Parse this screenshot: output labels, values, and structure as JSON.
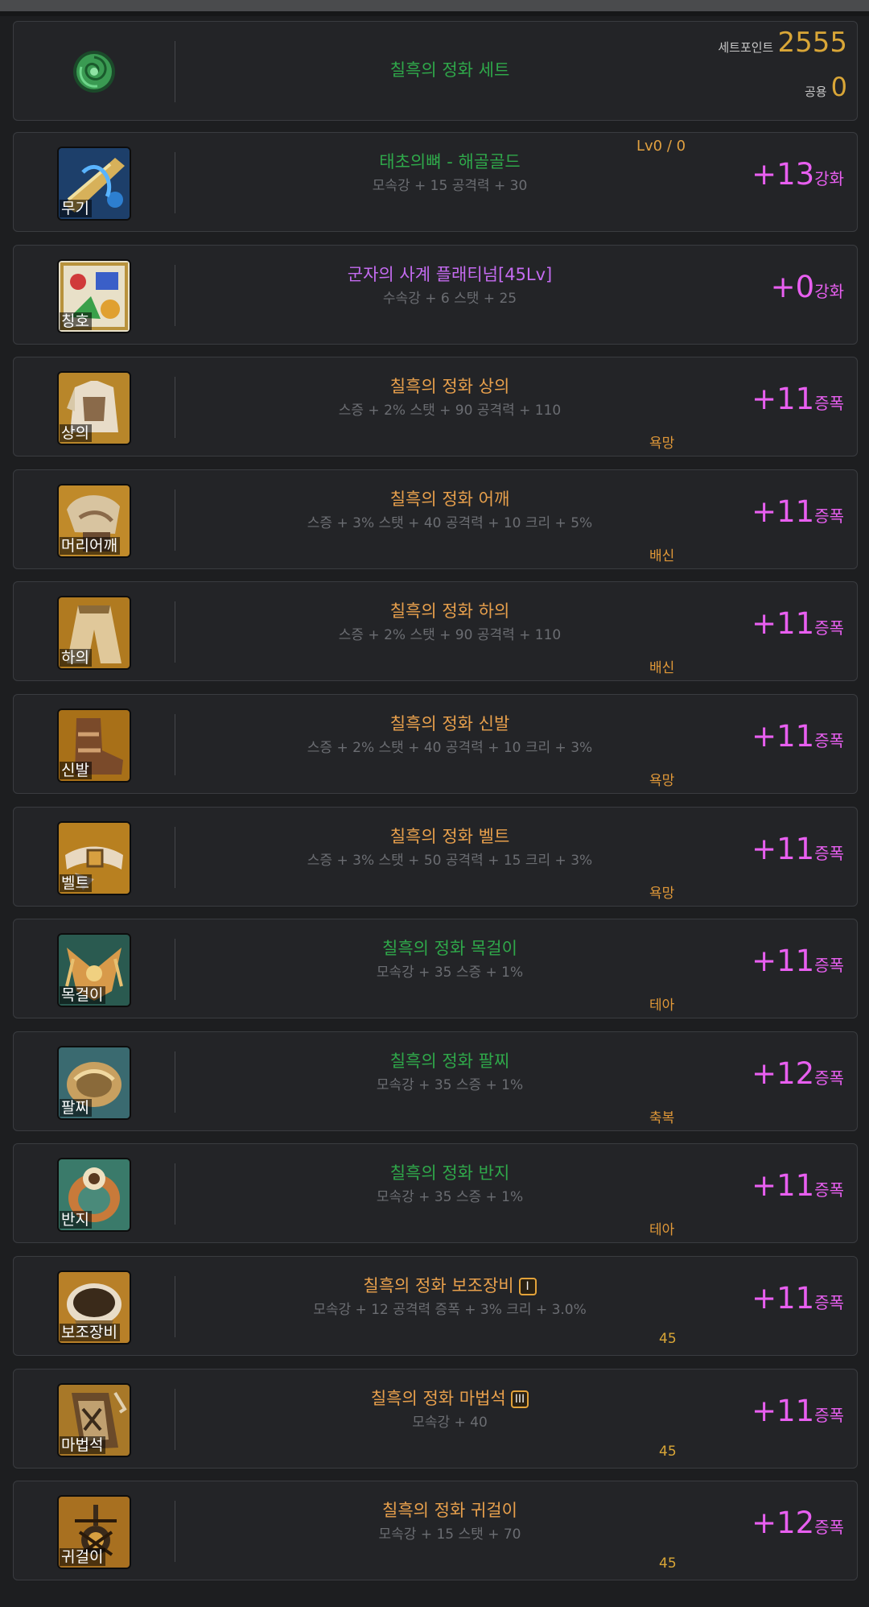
{
  "set": {
    "name": "칠흑의 정화 세트",
    "point_label": "세트포인트",
    "point_value": "2555",
    "common_label": "공용",
    "common_value": "0",
    "icon": "green-rose-icon"
  },
  "colors": {
    "purple": "#e85ff0",
    "orange": "#e8a04c",
    "gold": "#d9a637",
    "green": "#2fa84a",
    "violet": "#c46bf0",
    "gray": "#6b6d72"
  },
  "items": [
    {
      "slot": "무기",
      "name": "태초의뼈 - 해골골드",
      "name_color": "green",
      "stats": "모속강 + 15 공격력 + 30",
      "level": "Lv0 / 0",
      "enh_value": "+13",
      "enh_unit": "강화",
      "icon": "weapon-icon"
    },
    {
      "slot": "칭호",
      "name": "군자의 사계 플래티넘[45Lv]",
      "name_color": "violet",
      "stats": "수속강 + 6 스탯 + 25",
      "enh_value": "+0",
      "enh_unit": "강화",
      "icon": "title-icon"
    },
    {
      "slot": "상의",
      "name": "칠흑의 정화 상의",
      "name_color": "orange",
      "stats": "스증 + 2% 스탯 + 90 공격력 + 110",
      "tag": "욕망",
      "enh_value": "+11",
      "enh_unit": "증폭",
      "icon": "top-armor-icon"
    },
    {
      "slot": "머리어깨",
      "name": "칠흑의 정화 어깨",
      "name_color": "orange",
      "stats": "스증 + 3% 스탯 + 40 공격력 + 10 크리 + 5%",
      "tag": "배신",
      "enh_value": "+11",
      "enh_unit": "증폭",
      "icon": "shoulder-armor-icon"
    },
    {
      "slot": "하의",
      "name": "칠흑의 정화 하의",
      "name_color": "orange",
      "stats": "스증 + 2% 스탯 + 90 공격력 + 110",
      "tag": "배신",
      "enh_value": "+11",
      "enh_unit": "증폭",
      "icon": "bottom-armor-icon"
    },
    {
      "slot": "신발",
      "name": "칠흑의 정화 신발",
      "name_color": "orange",
      "stats": "스증 + 2% 스탯 + 40 공격력 + 10 크리 + 3%",
      "tag": "욕망",
      "enh_value": "+11",
      "enh_unit": "증폭",
      "icon": "shoes-icon"
    },
    {
      "slot": "벨트",
      "name": "칠흑의 정화 벨트",
      "name_color": "orange",
      "stats": "스증 + 3% 스탯 + 50 공격력 + 15 크리 + 3%",
      "tag": "욕망",
      "enh_value": "+11",
      "enh_unit": "증폭",
      "icon": "belt-icon"
    },
    {
      "slot": "목걸이",
      "name": "칠흑의 정화 목걸이",
      "name_color": "green",
      "stats": "모속강 + 35 스증 + 1%",
      "tag": "테아",
      "enh_value": "+11",
      "enh_unit": "증폭",
      "icon": "necklace-icon"
    },
    {
      "slot": "팔찌",
      "name": "칠흑의 정화 팔찌",
      "name_color": "green",
      "stats": "모속강 + 35 스증 + 1%",
      "tag": "축복",
      "enh_value": "+12",
      "enh_unit": "증폭",
      "icon": "bracelet-icon"
    },
    {
      "slot": "반지",
      "name": "칠흑의 정화 반지",
      "name_color": "green",
      "stats": "모속강 + 35 스증 + 1%",
      "tag": "테아",
      "enh_value": "+11",
      "enh_unit": "증폭",
      "icon": "ring-icon"
    },
    {
      "slot": "보조장비",
      "name": "칠흑의 정화 보조장비",
      "name_color": "orange",
      "badge": "I",
      "stats": "모속강 + 12 공격력 증폭 + 3% 크리 + 3.0%",
      "tag": "45",
      "enh_value": "+11",
      "enh_unit": "증폭",
      "icon": "sub-equipment-icon"
    },
    {
      "slot": "마법석",
      "name": "칠흑의 정화 마법석",
      "name_color": "orange",
      "badge": "III",
      "stats": "모속강 + 40",
      "tag": "45",
      "enh_value": "+11",
      "enh_unit": "증폭",
      "icon": "magic-stone-icon"
    },
    {
      "slot": "귀걸이",
      "name": "칠흑의 정화 귀걸이",
      "name_color": "orange",
      "stats": "모속강 + 15 스탯 + 70",
      "tag": "45",
      "enh_value": "+12",
      "enh_unit": "증폭",
      "icon": "earring-icon"
    }
  ]
}
